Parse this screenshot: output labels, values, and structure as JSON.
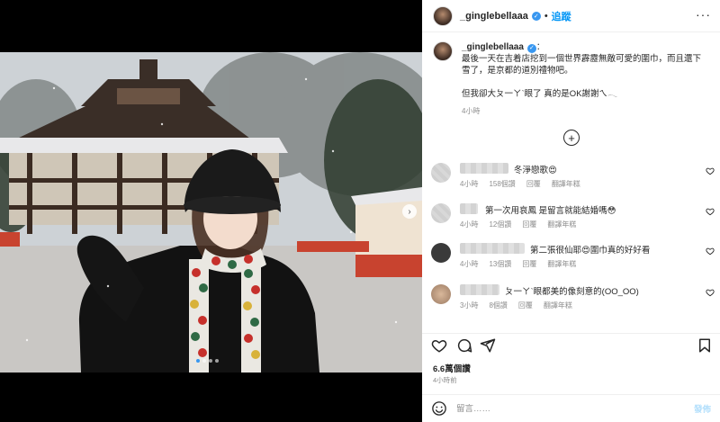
{
  "post": {
    "username": "_ginglebellaaa",
    "verified_glyph": "✓",
    "separator": "•",
    "follow_label": "追蹤",
    "more_label": "···"
  },
  "caption": {
    "username": "_ginglebellaaa",
    "colon": "：",
    "lines": [
      "最後一天在吉着店挖到一個世界霹靂無敵可愛的圍巾，而且還下",
      "雪了，是京都的道別禮物吧。",
      "",
      "但我卻大ㄆ一ㄚˋ眼了 真的是OK謝謝ㄟ𓂃"
    ],
    "time": "4小時"
  },
  "load_more_glyph": "+",
  "comments": [
    {
      "text": "冬淨戀歌😍",
      "time": "4小時",
      "likes": "158個讚",
      "reply": "回覆",
      "translate": "翻譯年糕"
    },
    {
      "text": "第一次用哀鳳 是留言就能結婚嗎😳",
      "time": "4小時",
      "likes": "12個讚",
      "reply": "回覆",
      "translate": "翻譯年糕"
    },
    {
      "text": "第二張很仙耶😍圍巾真的好好看",
      "time": "4小時",
      "likes": "13個讚",
      "reply": "回覆",
      "translate": "翻譯年糕"
    },
    {
      "text": "ㄆ一ㄚˋ眼都美的像刻意的(OO_OO)",
      "time": "3小時",
      "likes": "8個讚",
      "reply": "回覆",
      "translate": "翻譯年糕"
    }
  ],
  "likes": "6.6萬個讚",
  "posted": "4小時前",
  "composer": {
    "placeholder": "留言……",
    "post_label": "發佈"
  },
  "icons": {
    "heart": "heart-icon",
    "comment": "comment-icon",
    "share": "share-icon",
    "save": "bookmark-icon",
    "emoji": "emoji-icon",
    "next": "chevron-right-icon"
  },
  "colors": {
    "accent": "#0095f6",
    "verified": "#3897f0",
    "muted": "#8e8e8e"
  }
}
